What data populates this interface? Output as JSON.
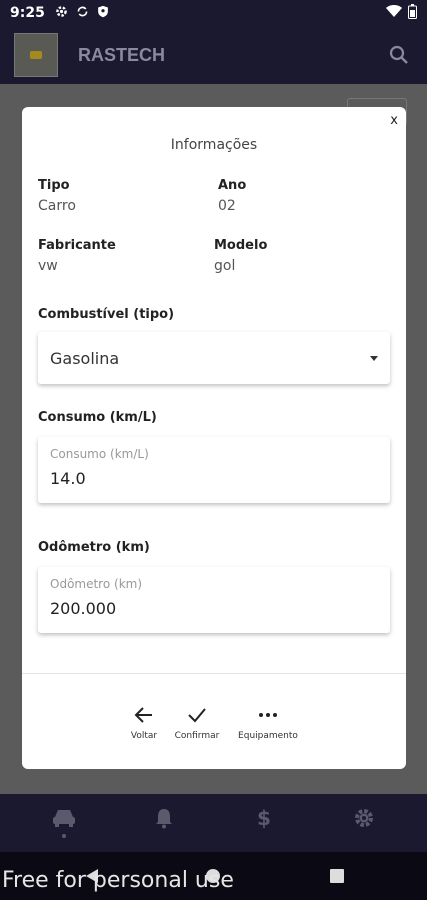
{
  "status_bar": {
    "time": "9:25",
    "icons": [
      "gear-icon",
      "sync-icon",
      "shield-icon"
    ],
    "right_icons": [
      "wifi-icon",
      "battery-icon"
    ]
  },
  "app_bar": {
    "title": "RASTECH",
    "logo_icon": "app-logo",
    "search_icon": "search-icon"
  },
  "dialog": {
    "close_label": "x",
    "title": "Informações",
    "info": {
      "tipo_label": "Tipo",
      "tipo_value": "Carro",
      "ano_label": "Ano",
      "ano_value": "02",
      "fabricante_label": "Fabricante",
      "fabricante_value": "vw",
      "modelo_label": "Modelo",
      "modelo_value": "gol"
    },
    "combustivel": {
      "label": "Combustível (tipo)",
      "selected": "Gasolina"
    },
    "consumo": {
      "label": "Consumo (km/L)",
      "placeholder": "Consumo (km/L)",
      "value": "14.0"
    },
    "odometro": {
      "label": "Odômetro (km)",
      "placeholder": "Odômetro (km)",
      "value": "200.000"
    },
    "actions": [
      {
        "label": "Voltar",
        "icon": "arrow-left-icon"
      },
      {
        "label": "Confirmar",
        "icon": "check-icon"
      },
      {
        "label": "Equipamento",
        "icon": "more-horizontal-icon"
      }
    ]
  },
  "bottom_nav": {
    "items": [
      "car-icon",
      "bell-icon",
      "dollar-icon",
      "settings-icon"
    ],
    "active_index": 0
  },
  "watermark": "Free for personal use",
  "colors": {
    "app_bar": "#1a1930",
    "backdrop": "#5b5b5c",
    "dialog_bg": "#ffffff",
    "nav_icon": "#5a5a6c"
  }
}
